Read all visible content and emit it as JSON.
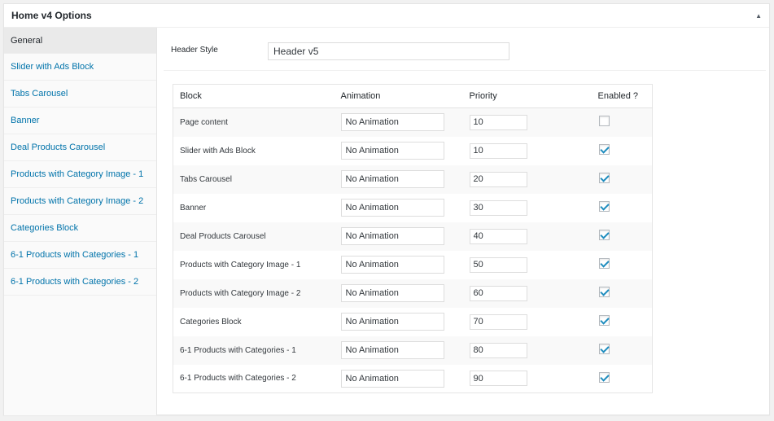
{
  "panel": {
    "title": "Home v4 Options",
    "toggle_icon": "▲"
  },
  "sidebar": {
    "items": [
      {
        "label": "General",
        "active": true
      },
      {
        "label": "Slider with Ads Block"
      },
      {
        "label": "Tabs Carousel"
      },
      {
        "label": "Banner"
      },
      {
        "label": "Deal Products Carousel"
      },
      {
        "label": "Products with Category Image - 1"
      },
      {
        "label": "Products with Category Image - 2"
      },
      {
        "label": "Categories Block"
      },
      {
        "label": "6-1 Products with Categories - 1"
      },
      {
        "label": "6-1 Products with Categories - 2"
      }
    ]
  },
  "header_style": {
    "label": "Header Style",
    "value": "Header v5"
  },
  "table": {
    "headers": {
      "block": "Block",
      "animation": "Animation",
      "priority": "Priority",
      "enabled": "Enabled ?"
    },
    "rows": [
      {
        "block": "Page content",
        "animation": "No Animation",
        "priority": "10",
        "enabled": false
      },
      {
        "block": "Slider with Ads Block",
        "animation": "No Animation",
        "priority": "10",
        "enabled": true
      },
      {
        "block": "Tabs Carousel",
        "animation": "No Animation",
        "priority": "20",
        "enabled": true
      },
      {
        "block": "Banner",
        "animation": "No Animation",
        "priority": "30",
        "enabled": true
      },
      {
        "block": "Deal Products Carousel",
        "animation": "No Animation",
        "priority": "40",
        "enabled": true
      },
      {
        "block": "Products with Category Image - 1",
        "animation": "No Animation",
        "priority": "50",
        "enabled": true
      },
      {
        "block": "Products with Category Image - 2",
        "animation": "No Animation",
        "priority": "60",
        "enabled": true
      },
      {
        "block": "Categories Block",
        "animation": "No Animation",
        "priority": "70",
        "enabled": true
      },
      {
        "block": "6-1 Products with Categories - 1",
        "animation": "No Animation",
        "priority": "80",
        "enabled": true
      },
      {
        "block": "6-1 Products with Categories - 2",
        "animation": "No Animation",
        "priority": "90",
        "enabled": true
      }
    ]
  },
  "colors": {
    "link": "#0073aa",
    "check": "#1e8cbe",
    "background": "#f1f1f1"
  }
}
